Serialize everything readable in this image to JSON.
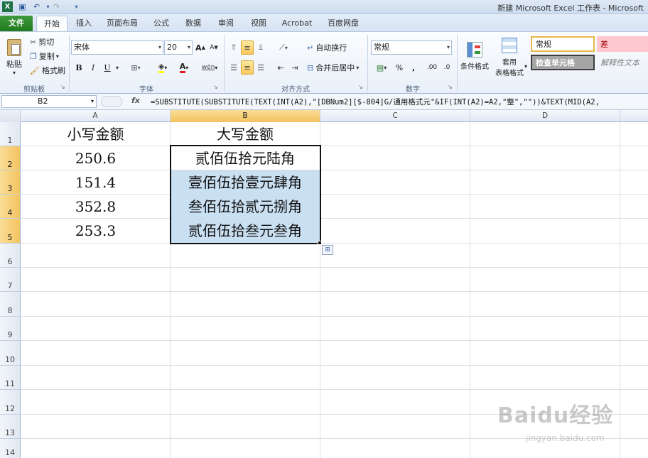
{
  "window": {
    "title": "新建 Microsoft Excel 工作表 - Microsoft"
  },
  "tabs": [
    "文件",
    "开始",
    "插入",
    "页面布局",
    "公式",
    "数据",
    "审阅",
    "视图",
    "Acrobat",
    "百度网盘"
  ],
  "clipboard": {
    "paste": "粘贴",
    "cut": "剪切",
    "copy": "复制",
    "format_painter": "格式刷",
    "group": "剪贴板"
  },
  "font": {
    "name": "宋体",
    "size": "20",
    "bold": "B",
    "italic": "I",
    "underline": "U",
    "wen": "wén",
    "group": "字体"
  },
  "alignment": {
    "wrap": "自动换行",
    "merge": "合并后居中",
    "group": "对齐方式"
  },
  "number": {
    "format": "常规",
    "percent": "%",
    "comma": ",",
    "inc_dec": ".00",
    "group": "数字"
  },
  "styles": {
    "conditional": "条件格式",
    "table_format_1": "套用",
    "table_format_2": "表格格式",
    "normal": "常规",
    "bad": "差",
    "check_cell": "检查单元格",
    "explanatory": "解释性文本"
  },
  "formula_bar": {
    "name_box": "B2",
    "fx": "fx",
    "formula": "=SUBSTITUTE(SUBSTITUTE(TEXT(INT(A2),\"[DBNum2][$-804]G/通用格式元\"&IF(INT(A2)=A2,\"整\",\"\"))&TEXT(MID(A2,"
  },
  "columns": [
    "A",
    "B",
    "C",
    "D"
  ],
  "rows": [
    "1",
    "2",
    "3",
    "4",
    "5",
    "6",
    "7",
    "8",
    "9",
    "10",
    "11",
    "12",
    "13",
    "14"
  ],
  "sheet": {
    "headers": [
      "小写金额",
      "大写金额"
    ],
    "data": [
      {
        "a": "250.6",
        "b": "贰佰伍拾元陆角"
      },
      {
        "a": "151.4",
        "b": "壹佰伍拾壹元肆角"
      },
      {
        "a": "352.8",
        "b": "叁佰伍拾贰元捌角"
      },
      {
        "a": "253.3",
        "b": "贰佰伍拾叁元叁角"
      }
    ]
  },
  "watermark": {
    "brand": "Baidu经验",
    "url": "jingyan.baidu.com"
  }
}
